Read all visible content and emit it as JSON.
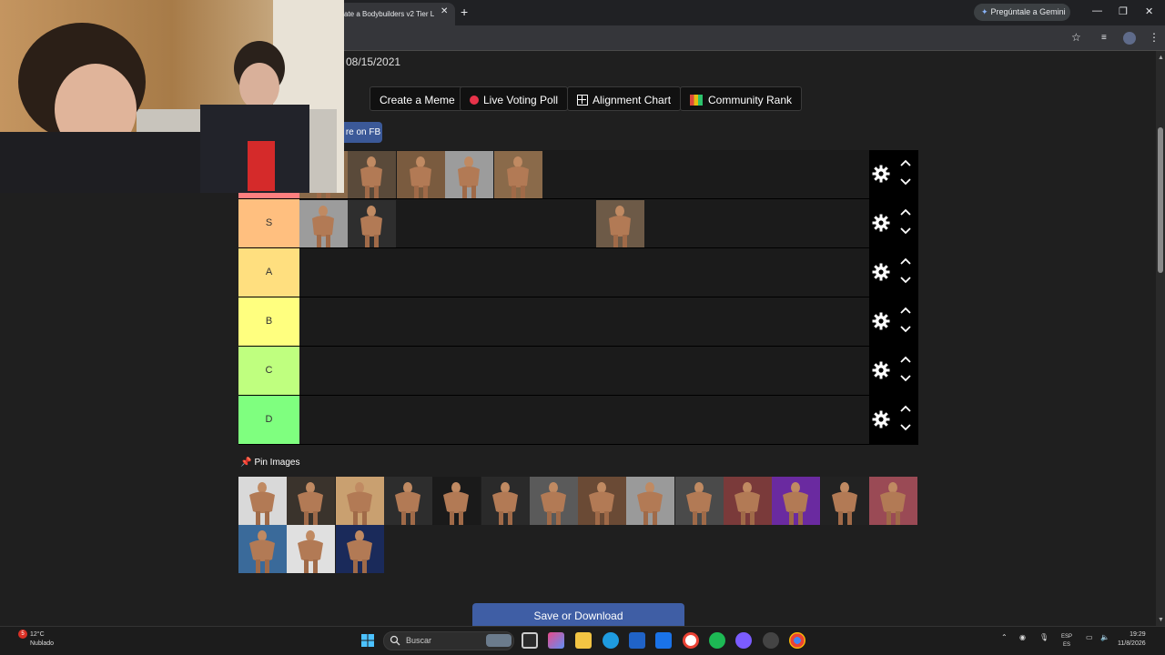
{
  "browser": {
    "tab_title": "ate a Bodybuilders v2 Tier L",
    "tab_close": "✕",
    "new_tab": "+",
    "gemini_label": "Pregúntale a Gemini",
    "win_minimize": "—",
    "win_restore": "❐",
    "win_close": "✕"
  },
  "page": {
    "date": "08/15/2021",
    "buttons": {
      "create_meme": "Create a Meme",
      "live_poll": "Live Voting Poll",
      "alignment_chart": "Alignment Chart",
      "community_rank": "Community Rank"
    },
    "share_fb": "re on FB",
    "tiers": [
      {
        "label": "",
        "color": "#ff7f7f"
      },
      {
        "label": "S",
        "color": "#ffbf7f"
      },
      {
        "label": "A",
        "color": "#ffdf7f"
      },
      {
        "label": "B",
        "color": "#ffff7f"
      },
      {
        "label": "C",
        "color": "#bfff7f"
      },
      {
        "label": "D",
        "color": "#7fff7f"
      }
    ],
    "pin_images": "Pin Images",
    "save_download": "Save or Download"
  },
  "taskbar": {
    "weather_badge": "5",
    "temp": "12°C",
    "condition": "Nublado",
    "search_placeholder": "Buscar",
    "lang_top": "ESP",
    "lang_bottom": "ES",
    "time": "19:29",
    "date": "11/8/2026"
  }
}
